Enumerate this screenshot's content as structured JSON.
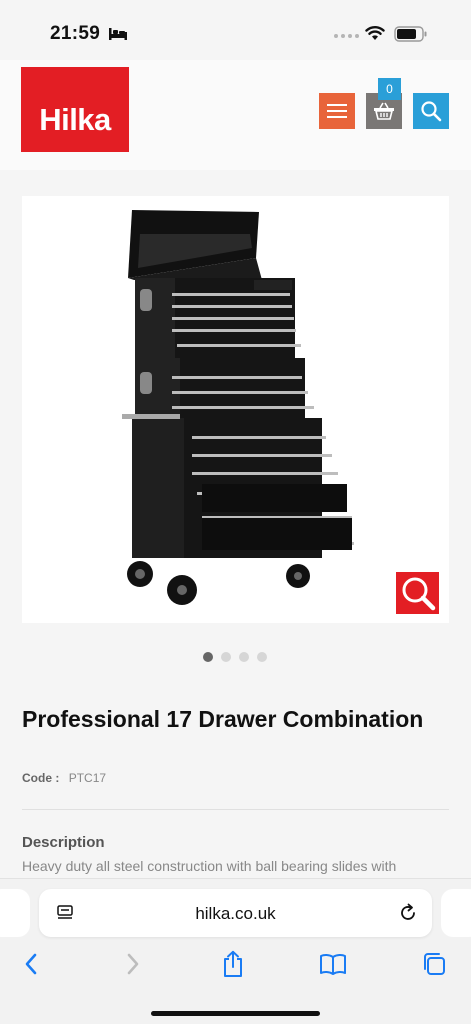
{
  "status_bar": {
    "time": "21:59",
    "icons": [
      "bed-icon",
      "signal-icon",
      "wifi-icon",
      "battery-icon"
    ]
  },
  "header": {
    "logo_text": "Hilka",
    "basket_count": "0",
    "buttons": [
      "menu-icon",
      "basket-icon",
      "search-icon"
    ]
  },
  "colors": {
    "brand_red": "#e31e24",
    "menu_orange": "#e8643a",
    "basket_grey": "#7a7775",
    "search_blue": "#2a9fd8"
  },
  "carousel": {
    "total": 4,
    "active_index": 0
  },
  "product": {
    "title": "Professional 17 Drawer Combination",
    "code_label": "Code :",
    "code_value": "PTC17",
    "description_heading": "Description",
    "description_text": "Heavy duty all steel construction with ball bearing slides with"
  },
  "browser": {
    "url": "hilka.co.uk",
    "toolbar": [
      "back-icon",
      "forward-icon",
      "share-icon",
      "bookmarks-icon",
      "tabs-icon"
    ]
  }
}
